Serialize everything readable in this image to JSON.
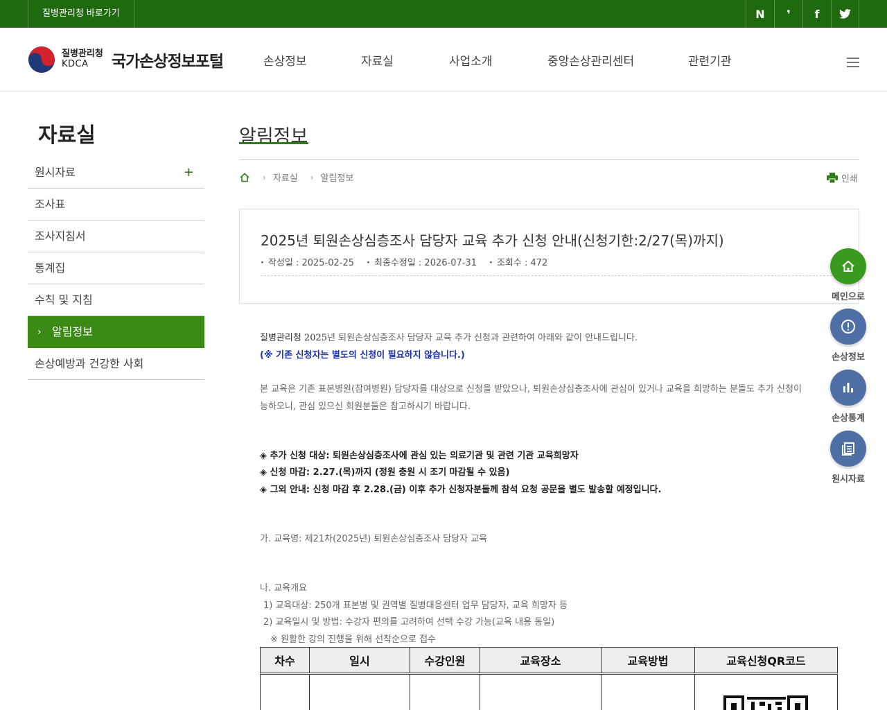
{
  "topbar": {
    "shortcut_label": "질병관리청 바로가기",
    "sns": [
      {
        "icon": "naver-blog-icon",
        "glyph": "N"
      },
      {
        "icon": "kakao-story-icon",
        "glyph": "❜"
      },
      {
        "icon": "facebook-icon",
        "glyph": "f"
      },
      {
        "icon": "twitter-icon",
        "glyph": "🐦"
      }
    ]
  },
  "header": {
    "org_ko": "질병관리청",
    "org_en": "KDCA",
    "portal_name": "국가손상정보포털",
    "gnb": [
      "손상정보",
      "자료실",
      "사업소개",
      "중앙손상관리센터",
      "관련기관"
    ]
  },
  "sidebar": {
    "title": "자료실",
    "items": [
      {
        "label": "원시자료",
        "expandable": true,
        "plus": "+"
      },
      {
        "label": "조사표"
      },
      {
        "label": "조사지침서"
      },
      {
        "label": "통계집"
      },
      {
        "label": "수칙 및 지침"
      },
      {
        "label": "알림정보",
        "active": true,
        "arrow": "›"
      },
      {
        "label": "손상예방과 건강한 사회"
      }
    ]
  },
  "content": {
    "title": "알림정보",
    "breadcrumb": [
      "자료실",
      "알림정보"
    ],
    "print_label": "인쇄"
  },
  "post": {
    "subject": "2025년 퇴원손상심층조사 담당자 교육 추가 신청 안내(신청기한:2/27(목)까지)",
    "meta": [
      "작성일 : 2025-02-25",
      "최종수정일 : 2026-07-31",
      "조회수 : 472"
    ],
    "body": {
      "line1_prefix": "질병관리청 2025",
      "line1_rest": "년 퇴원손상심층조사 담당자 교육 추가 신청과 관련하여 아래와 같이 안내드립니다.",
      "line2": "(※ 기존 신청자는 별도의 신청이 필요하지 않습니다.)",
      "line3": "본 교육은 기존 표본병원(참여병원) 담당자를 대상으로 신청을 받았으나, 퇴원손상심층조사에 관심이 있거나 교육을 희망하는 분들도 추가 신청이",
      "line4": "능하오니, 관심 있으신 회원분들은 참고하시기 바랍니다.",
      "bullet1": "◈ 추가 신청 대상: 퇴원손상심층조사에 관심 있는 의료기관 및 관련 기관 교육희망자",
      "bullet2": "◈ 신청 마감: 2.27.(목)까지 (정원 충원 시 조기 마감될 수 있음)",
      "bullet3": "◈ 그외 안내: 신청 마감 후 2.28.(금) 이후 추가 신청자분들께 참석 요청 공문을 별도 발송할 예정입니다.",
      "ga": "가. 교육명: 제21차(2025년) 퇴원손상심층조사 담당자 교육",
      "na": "나. 교육개요",
      "na1": "1) 교육대상: 250개 표본병 및 권역별 질병대응센터 업무 담당자, 교육 희망자 등",
      "na2": "2) 교육일시 및 방법: 수강자 편의를 고려하여 선택 수강 가능(교육 내용 동일)",
      "na2_note": "※ 원활한 강의 진행을 위해 선착순으로 접수"
    },
    "table_headers": [
      "차수",
      "일시",
      "수강인원",
      "교육장소",
      "교육방법",
      "교육신청QR코드"
    ]
  },
  "quick_menu": [
    {
      "label": "메인으로",
      "icon": "home-icon",
      "color": "#3a9a1e"
    },
    {
      "label": "손상정보",
      "icon": "alert-circle-icon",
      "color": "#4e6fa5"
    },
    {
      "label": "손상통계",
      "icon": "bar-chart-icon",
      "color": "#4e6fa5"
    },
    {
      "label": "원시자료",
      "icon": "document-list-icon",
      "color": "#4e6fa5"
    }
  ]
}
